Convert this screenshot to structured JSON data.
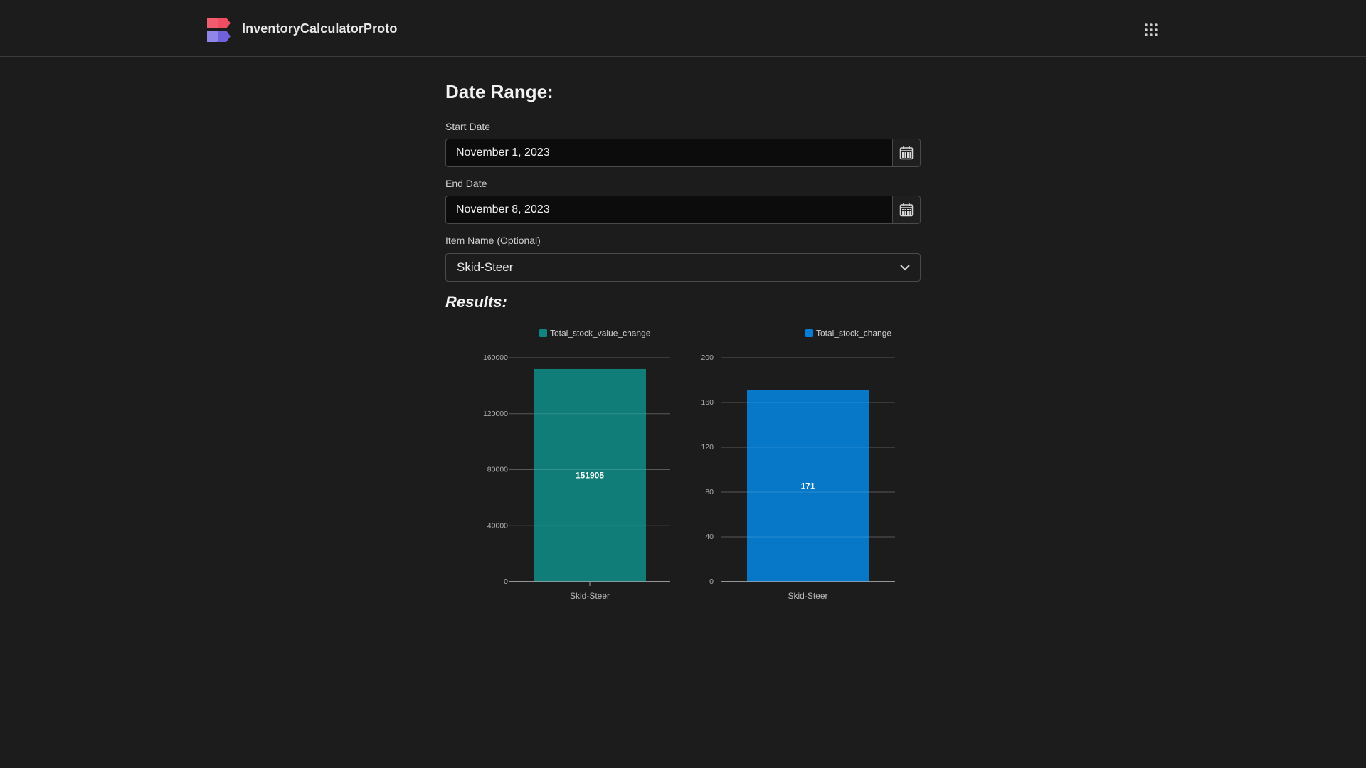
{
  "header": {
    "app_title": "InventoryCalculatorProto",
    "logo_icon": "app-logo",
    "apps_icon": "grid-icon"
  },
  "form": {
    "heading": "Date Range:",
    "start_date": {
      "label": "Start Date",
      "value": "November 1, 2023",
      "icon": "calendar-icon"
    },
    "end_date": {
      "label": "End Date",
      "value": "November 8, 2023",
      "icon": "calendar-icon"
    },
    "item_name": {
      "label": "Item Name (Optional)",
      "value": "Skid-Steer",
      "icon": "chevron-down-icon"
    }
  },
  "results": {
    "heading": "Results:"
  },
  "colors": {
    "background": "#1c1c1c",
    "teal": "#0f8580",
    "blue": "#057fd6"
  },
  "chart_data": [
    {
      "type": "bar",
      "categories": [
        "Skid-Steer"
      ],
      "series": [
        {
          "name": "Total_stock_value_change",
          "values": [
            151905
          ],
          "color": "#0f8580"
        }
      ],
      "data_labels": [
        "151905"
      ],
      "yticks": [
        "0",
        "40000",
        "80000",
        "120000",
        "160000"
      ],
      "ylim": [
        0,
        160000
      ],
      "grid": true,
      "legend": "top-right"
    },
    {
      "type": "bar",
      "categories": [
        "Skid-Steer"
      ],
      "series": [
        {
          "name": "Total_stock_change",
          "values": [
            171
          ],
          "color": "#057fd6"
        }
      ],
      "data_labels": [
        "171"
      ],
      "yticks": [
        "0",
        "40",
        "80",
        "120",
        "160",
        "200"
      ],
      "ylim": [
        0,
        200
      ],
      "grid": true,
      "legend": "top-right"
    }
  ]
}
